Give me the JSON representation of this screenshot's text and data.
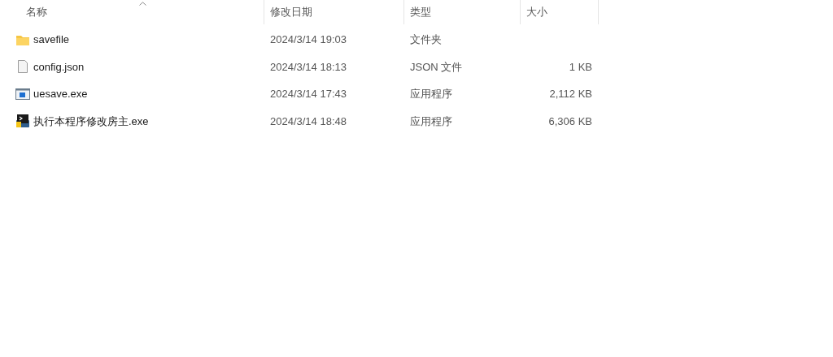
{
  "columns": [
    {
      "label": "名称",
      "sorted": true
    },
    {
      "label": "修改日期",
      "sorted": false
    },
    {
      "label": "类型",
      "sorted": false
    },
    {
      "label": "大小",
      "sorted": false
    }
  ],
  "rows": [
    {
      "kind": "folder",
      "name": "savefile",
      "modified": "2024/3/14 19:03",
      "type": "文件夹",
      "selected": false
    },
    {
      "kind": "document",
      "name": "config.json",
      "modified": "2024/3/14 18:13",
      "type": "JSON 文件",
      "size": "1 KB",
      "selected": false
    },
    {
      "kind": "window-app",
      "name": "uesave.exe",
      "modified": "2024/3/14 17:43",
      "type": "应用程序",
      "size": "2,112 KB",
      "selected": false
    },
    {
      "kind": "script-app",
      "name": "执行本程序修改房主.exe",
      "modified": "2024/3/14 18:48",
      "type": "应用程序",
      "size": "6,306 KB",
      "selected": false
    }
  ]
}
